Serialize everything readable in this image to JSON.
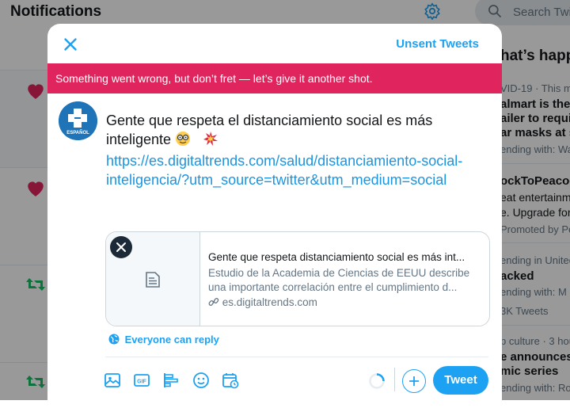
{
  "background": {
    "title": "Notifications",
    "search_placeholder": "Search Twitter",
    "right_panel": {
      "heading": "hat’s happ",
      "trends": [
        {
          "meta": "VID-19 · This m",
          "lines": [
            "almart is the l",
            "ailer to requi",
            "ar masks at s"
          ],
          "extra": "ending with: Walm"
        },
        {
          "meta": "",
          "lines": [
            "ockToPeacoc"
          ],
          "extra2": [
            "eat entertainm",
            "e. Upgrade for"
          ],
          "extra": "Promoted by Pe"
        },
        {
          "meta": "ending in United",
          "lines": [
            "acked"
          ],
          "extra2": [
            "ending with: M"
          ],
          "extra": "3K Tweets"
        },
        {
          "meta": "p culture · 3 hou",
          "lines": [
            "e announces r",
            "mic series"
          ],
          "extra": "ending with: Rors"
        }
      ]
    }
  },
  "modal": {
    "close_icon": "close-icon",
    "unsent_label": "Unsent Tweets",
    "error_message": "Something went wrong, but don’t fret — let’s give it another shot.",
    "avatar_label": "ESPAÑOL",
    "tweet": {
      "text_line1": "Gente que respeta el distanciamiento social es más",
      "text_line2": "inteligente",
      "link_line1": "https://es.digitaltrends.com/salud/distanciamiento-social-",
      "link_line2": "inteligencia/?utm_source=twitter&utm_medium=social"
    },
    "card": {
      "title": "Gente que respeta distanciamiento social es más int...",
      "desc_line1": "Estudio de la Academia de Ciencias de EEUU describe",
      "desc_line2": "una importante correlación entre el cumplimiento d...",
      "domain": "es.digitaltrends.com"
    },
    "reply_setting": "Everyone can reply",
    "toolbar_icons": [
      "image-icon",
      "gif-icon",
      "poll-icon",
      "emoji-icon",
      "schedule-icon"
    ],
    "tweet_button": "Tweet"
  },
  "colors": {
    "accent": "#1da1f2",
    "error": "#e0245e",
    "like": "#e0245e",
    "retweet": "#17bf63"
  }
}
